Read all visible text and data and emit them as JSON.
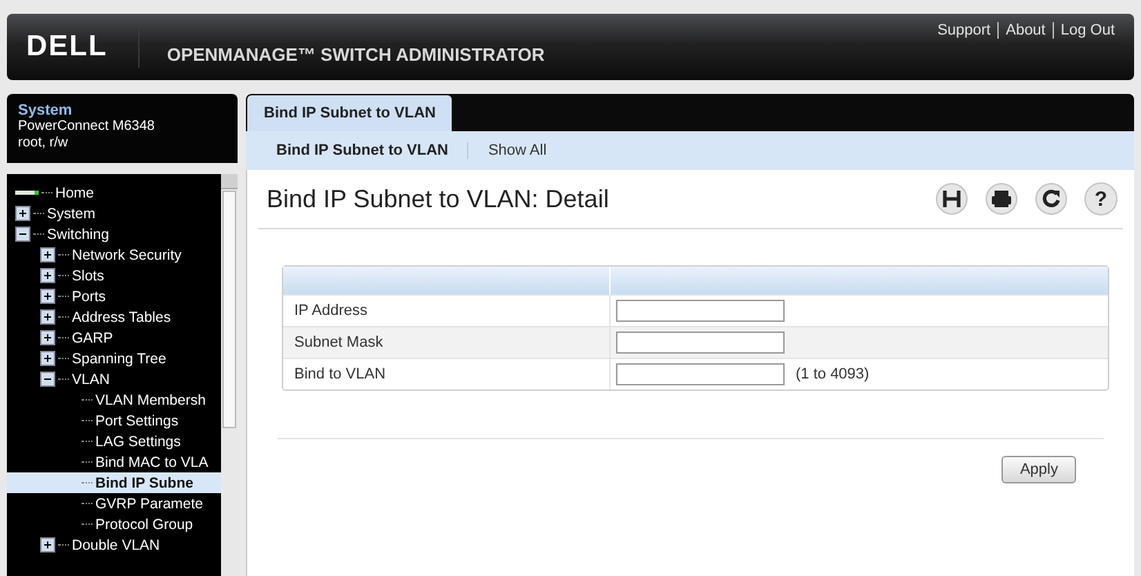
{
  "header": {
    "brand": "DELL",
    "title": "OPENMANAGE™ SWITCH ADMINISTRATOR",
    "links": [
      "Support",
      "About",
      "Log Out"
    ]
  },
  "system_info": {
    "title": "System",
    "device": "PowerConnect M6348",
    "user": "root, r/w"
  },
  "tree": [
    {
      "label": "Home",
      "kind": "home",
      "selected": false
    },
    {
      "label": "System",
      "kind": "folder",
      "expanded": false,
      "selected": false
    },
    {
      "label": "Switching",
      "kind": "folder",
      "expanded": true,
      "selected": false,
      "children": [
        {
          "label": "Network Security",
          "kind": "folder",
          "expanded": false,
          "selected": false
        },
        {
          "label": "Slots",
          "kind": "folder",
          "expanded": false,
          "selected": false
        },
        {
          "label": "Ports",
          "kind": "folder",
          "expanded": false,
          "selected": false
        },
        {
          "label": "Address Tables",
          "kind": "folder",
          "expanded": false,
          "selected": false
        },
        {
          "label": "GARP",
          "kind": "folder",
          "expanded": false,
          "selected": false
        },
        {
          "label": "Spanning Tree",
          "kind": "folder",
          "expanded": false,
          "selected": false
        },
        {
          "label": "VLAN",
          "kind": "folder",
          "expanded": true,
          "selected": false,
          "children": [
            {
              "label": "VLAN Membersh",
              "kind": "page",
              "selected": false
            },
            {
              "label": "Port Settings",
              "kind": "page",
              "selected": false
            },
            {
              "label": "LAG Settings",
              "kind": "page",
              "selected": false
            },
            {
              "label": "Bind MAC to VLA",
              "kind": "page",
              "selected": false
            },
            {
              "label": "Bind IP Subne",
              "kind": "page",
              "selected": true
            },
            {
              "label": "GVRP Paramete",
              "kind": "page",
              "selected": false
            },
            {
              "label": "Protocol Group",
              "kind": "page",
              "selected": false
            }
          ]
        },
        {
          "label": "Double VLAN",
          "kind": "folder",
          "expanded": false,
          "selected": false
        }
      ]
    }
  ],
  "tabs": [
    {
      "label": "Bind IP Subnet to VLAN",
      "selected": true
    }
  ],
  "subtabs": [
    {
      "label": "Bind IP Subnet to VLAN",
      "selected": true
    },
    {
      "label": "Show All",
      "selected": false
    }
  ],
  "page_title": "Bind IP Subnet to VLAN: Detail",
  "toolbar": [
    {
      "kind": "save"
    },
    {
      "kind": "print"
    },
    {
      "kind": "refresh"
    },
    {
      "kind": "help",
      "glyph": "?"
    }
  ],
  "form": [
    {
      "label": "IP Address"
    },
    {
      "label": "Subnet Mask"
    },
    {
      "label": "Bind to VLAN",
      "hint": "(1 to 4093)"
    }
  ],
  "apply_button": "Apply"
}
